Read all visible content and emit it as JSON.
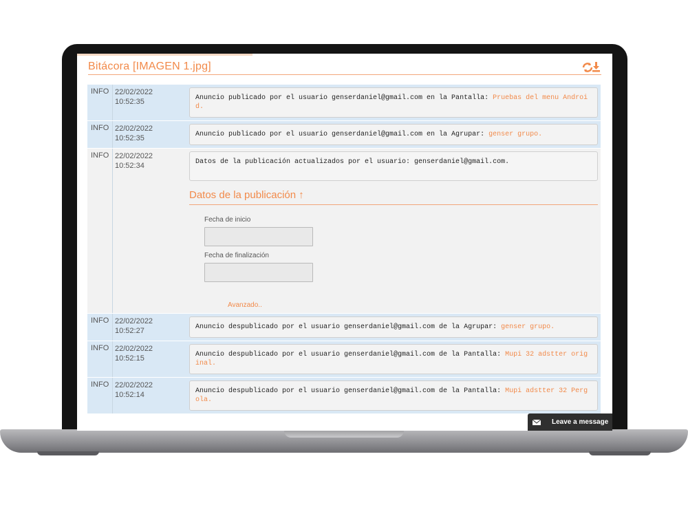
{
  "header": {
    "title": "Bitácora [IMAGEN 1.jpg]"
  },
  "log": [
    {
      "level": "INFO",
      "date": "22/02/2022",
      "time": "10:52:35",
      "message": "Anuncio publicado por el usuario  genserdaniel@gmail.com en la Pantalla: ",
      "highlight": "Pruebas del menu Android."
    },
    {
      "level": "INFO",
      "date": "22/02/2022",
      "time": "10:52:35",
      "message": "Anuncio publicado por el usuario  genserdaniel@gmail.com en la Agrupar: ",
      "highlight": "genser grupo."
    },
    {
      "level": "INFO",
      "date": "22/02/2022",
      "time": "10:52:34",
      "message": "Datos de la publicación actualizados por el usuario: genserdaniel@gmail.com.",
      "highlight": "",
      "details": {
        "section_title": "Datos de la publicación",
        "start_label": "Fecha de inicio",
        "start_value": "",
        "end_label": "Fecha de finalización",
        "end_value": "",
        "advanced_label": "Avanzado.."
      }
    },
    {
      "level": "INFO",
      "date": "22/02/2022",
      "time": "10:52:27",
      "message": "Anuncio despublicado por el usuario genserdaniel@gmail.com de la Agrupar: ",
      "highlight": "genser grupo."
    },
    {
      "level": "INFO",
      "date": "22/02/2022",
      "time": "10:52:15",
      "message": "Anuncio despublicado por el usuario genserdaniel@gmail.com de la Pantalla: ",
      "highlight": "Mupi 32 adstter original."
    },
    {
      "level": "INFO",
      "date": "22/02/2022",
      "time": "10:52:14",
      "message": "Anuncio despublicado por el usuario genserdaniel@gmail.com de la Pantalla: ",
      "highlight": "Mupi adstter 32 Pergola."
    }
  ],
  "chat": {
    "label": "Leave a message"
  },
  "icons": {
    "refresh": "refresh-download-icon",
    "section_arrow": "arrow-up-icon",
    "chat": "envelope-icon"
  },
  "colors": {
    "accent": "#f28a4a",
    "row_blue": "#d9e8f5",
    "row_gray": "#f2f2f2"
  }
}
